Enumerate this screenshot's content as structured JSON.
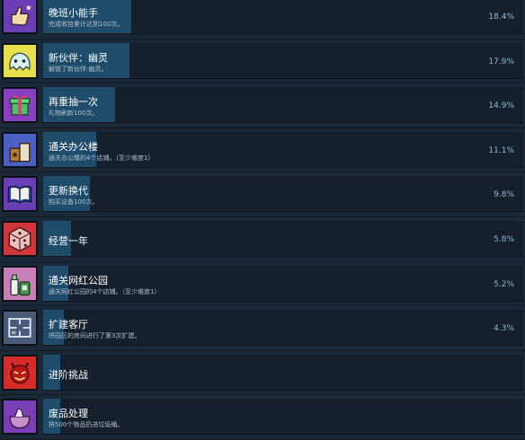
{
  "achievements": [
    {
      "title": "晚班小能手",
      "desc": "完成收拾累计达到100次。",
      "pct": "18.4%",
      "fill": 0.184,
      "icon": "thumbs-up-icon",
      "bg": "#6a3fb5"
    },
    {
      "title": "新伙伴：幽灵",
      "desc": "解锁了新伙伴:幽灵。",
      "pct": "17.9%",
      "fill": 0.179,
      "icon": "ghost-icon",
      "bg": "#e8e04a"
    },
    {
      "title": "再重抽一次",
      "desc": "礼物刷新100次。",
      "pct": "14.9%",
      "fill": 0.149,
      "icon": "gift-box-icon",
      "bg": "#8a3fc0"
    },
    {
      "title": "通关办公楼",
      "desc": "通关办公楼的4个店铺。（至少难度1）",
      "pct": "11.1%",
      "fill": 0.111,
      "icon": "coffee-bags-icon",
      "bg": "#4c5fc4"
    },
    {
      "title": "更新换代",
      "desc": "购买设备100次。",
      "pct": "9.8%",
      "fill": 0.098,
      "icon": "book-icon",
      "bg": "#6a3fb5"
    },
    {
      "title": "经营一年",
      "desc": "",
      "pct": "5.8%",
      "fill": 0.058,
      "icon": "dice-icon",
      "bg": "#d0363a"
    },
    {
      "title": "通关网红公园",
      "desc": "通关网红公园的4个店铺。（至少难度1）",
      "pct": "5.2%",
      "fill": 0.052,
      "icon": "bottles-icon",
      "bg": "#c87fb8"
    },
    {
      "title": "扩建客厅",
      "desc": "将园区的房间进行了第3次扩建。",
      "pct": "4.3%",
      "fill": 0.043,
      "icon": "floor-plan-icon",
      "bg": "#4a5a78"
    },
    {
      "title": "进阶挑战",
      "desc": "",
      "pct": "",
      "fill": 0.035,
      "icon": "devil-icon",
      "bg": "#d62b2b"
    },
    {
      "title": "废品处理",
      "desc": "将500个物品扔进垃圾桶。",
      "pct": "",
      "fill": 0.035,
      "icon": "trash-bag-icon",
      "bg": "#7a3fb5"
    }
  ]
}
